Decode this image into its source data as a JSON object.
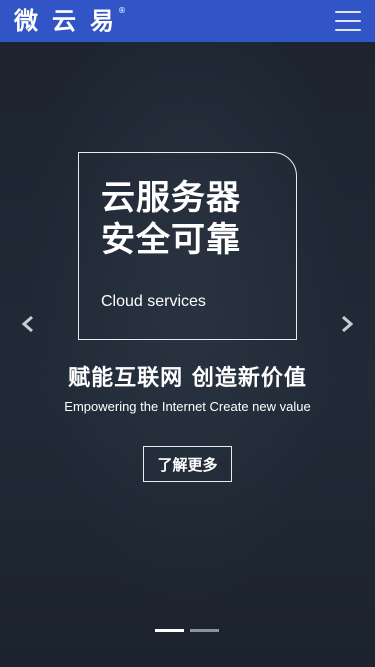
{
  "header": {
    "logo_text": "微云易",
    "logo_mark": "®",
    "menu_icon": "hamburger-menu-icon",
    "background_color": "#3155c6"
  },
  "banner": {
    "card": {
      "title": "云服务器 安全可靠",
      "subtitle": "Cloud services"
    },
    "headline": "赋能互联网 创造新价值",
    "subheadline": "Empowering the Internet Create new value",
    "cta_label": "了解更多",
    "prev_icon": "chevron-left-icon",
    "next_icon": "chevron-right-icon",
    "slides_count": 2,
    "active_slide": 1
  }
}
